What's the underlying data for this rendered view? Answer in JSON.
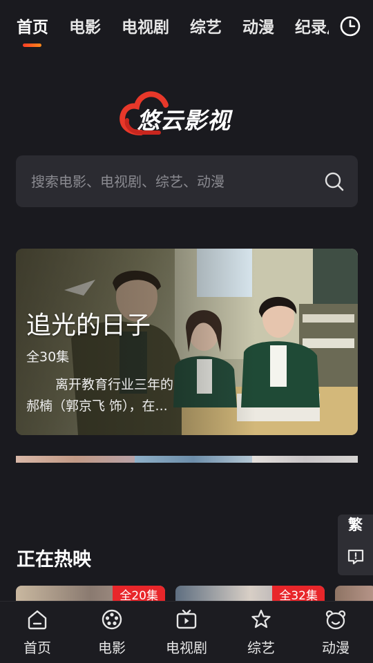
{
  "nav": {
    "tabs": [
      {
        "label": "首页",
        "active": true
      },
      {
        "label": "电影"
      },
      {
        "label": "电视剧"
      },
      {
        "label": "综艺"
      },
      {
        "label": "动漫"
      },
      {
        "label": "纪录片"
      }
    ],
    "history_icon": "clock-icon"
  },
  "logo": {
    "text": "悠云影视",
    "accent": "#e8382a"
  },
  "search": {
    "placeholder": "搜索电影、电视剧、综艺、动漫",
    "icon": "search-icon"
  },
  "banner": {
    "title": "追光的日子",
    "episodes": "全30集",
    "desc_line1": "离开教育行业三年的",
    "desc_line2": "郝楠（郭京飞 饰），在..."
  },
  "side_tools": {
    "traditional_label": "繁",
    "feedback_icon": "feedback-icon"
  },
  "now_showing": {
    "title": "正在热映",
    "cards": [
      {
        "badge": "全20集"
      },
      {
        "badge": "全32集"
      },
      {
        "badge": ""
      }
    ]
  },
  "bottom_nav": [
    {
      "label": "首页",
      "icon": "home-icon"
    },
    {
      "label": "电影",
      "icon": "film-reel-icon"
    },
    {
      "label": "电视剧",
      "icon": "tv-icon"
    },
    {
      "label": "综艺",
      "icon": "star-icon"
    },
    {
      "label": "动漫",
      "icon": "bear-face-icon"
    }
  ],
  "colors": {
    "background": "#1a1a1f",
    "search_bg": "#2b2b31",
    "badge": "#e8262a",
    "accent_gradient": [
      "#ff3d26",
      "#ff8a1a"
    ]
  }
}
